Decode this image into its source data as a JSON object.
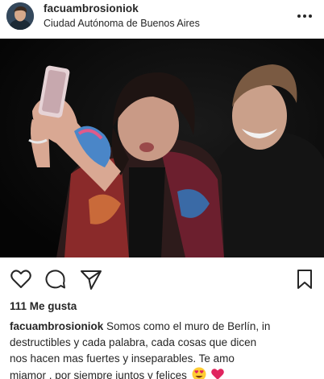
{
  "post": {
    "username": "facuambrosioniok",
    "location": "Ciudad Autónoma de Buenos Aires",
    "likes_text": "111 Me gusta",
    "caption": {
      "username": "facuambrosioniok",
      "line1": "Somos como el muro de Berlín, in",
      "line2": "destructibles y cada palabra, cada cosas que dicen",
      "line3": "nos hacen mas fuertes y inseparables. Te amo",
      "line4": "miamor , por siempre juntos y felices",
      "emojis": [
        "heart-eyes-emoji",
        "red-heart-emoji"
      ]
    }
  },
  "icons": {
    "more": "more-horizontal-icon",
    "like": "heart-outline-icon",
    "comment": "comment-bubble-icon",
    "share": "paper-plane-icon",
    "save": "bookmark-icon"
  },
  "colors": {
    "text": "#262626",
    "photo_background": "#0b0b0b",
    "heart_red": "#e0245e"
  }
}
